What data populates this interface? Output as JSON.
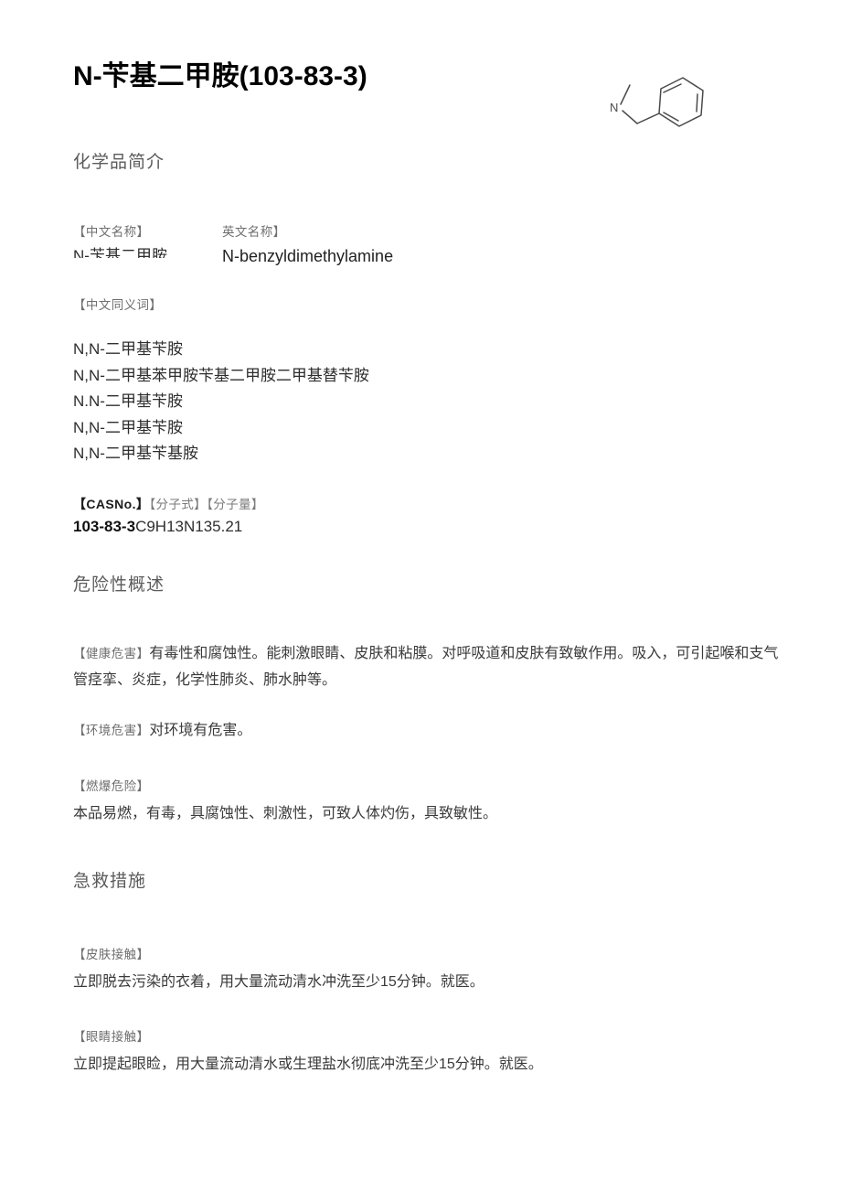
{
  "document": {
    "title": "N-苄基二甲胺(103-83-3)",
    "structure_alt": "benzene-ring-with-dimethylamino-methyl-group"
  },
  "sections": {
    "intro": {
      "heading": "化学品简介",
      "names": {
        "cn_label": "【中文名称】",
        "cn_value": "N-苄基二甲胺",
        "en_label": "英文名称】",
        "en_value": "N-benzyldimethylamine"
      },
      "synonyms": {
        "label": "【中文同义词】",
        "items": [
          "N,N-二甲基苄胺",
          "N,N-二甲基苯甲胺苄基二甲胺二甲基替苄胺",
          "N.N-二甲基苄胺",
          "N,N-二甲基苄胺",
          "N,N-二甲基苄基胺"
        ]
      },
      "identifiers": {
        "cas_label": "【CASNo.】",
        "formula_label": "【分子式】",
        "weight_label": "【分子量】",
        "cas_value": "103-83-3",
        "formula_value": "C9H13N",
        "weight_value": "135.21"
      }
    },
    "hazard": {
      "heading": "危险性概述",
      "health": {
        "label": "【健康危害】",
        "text": "有毒性和腐蚀性。能刺激眼睛、皮肤和粘膜。对呼吸道和皮肤有致敏作用。吸入，可引起喉和支气管痉挛、炎症，化学性肺炎、肺水肿等。"
      },
      "environment": {
        "label": "【环境危害】",
        "text": "对环境有危害。"
      },
      "fire": {
        "label": "【燃爆危险】",
        "text": "本品易燃，有毒，具腐蚀性、刺激性，可致人体灼伤，具致敏性。"
      }
    },
    "firstaid": {
      "heading": "急救措施",
      "skin": {
        "label": "【皮肤接触】",
        "text": "立即脱去污染的衣着，用大量流动清水冲洗至少15分钟。就医。"
      },
      "eye": {
        "label": "【眼睛接触】",
        "text": "立即提起眼睑，用大量流动清水或生理盐水彻底冲洗至少15分钟。就医。"
      }
    }
  },
  "colors": {
    "page_background": "#ffffff",
    "title": "#000000",
    "heading": "#5b5b5b",
    "label": "#6f6f6f",
    "body": "#3a3a3a",
    "structure_line": "#4a4a4a"
  }
}
